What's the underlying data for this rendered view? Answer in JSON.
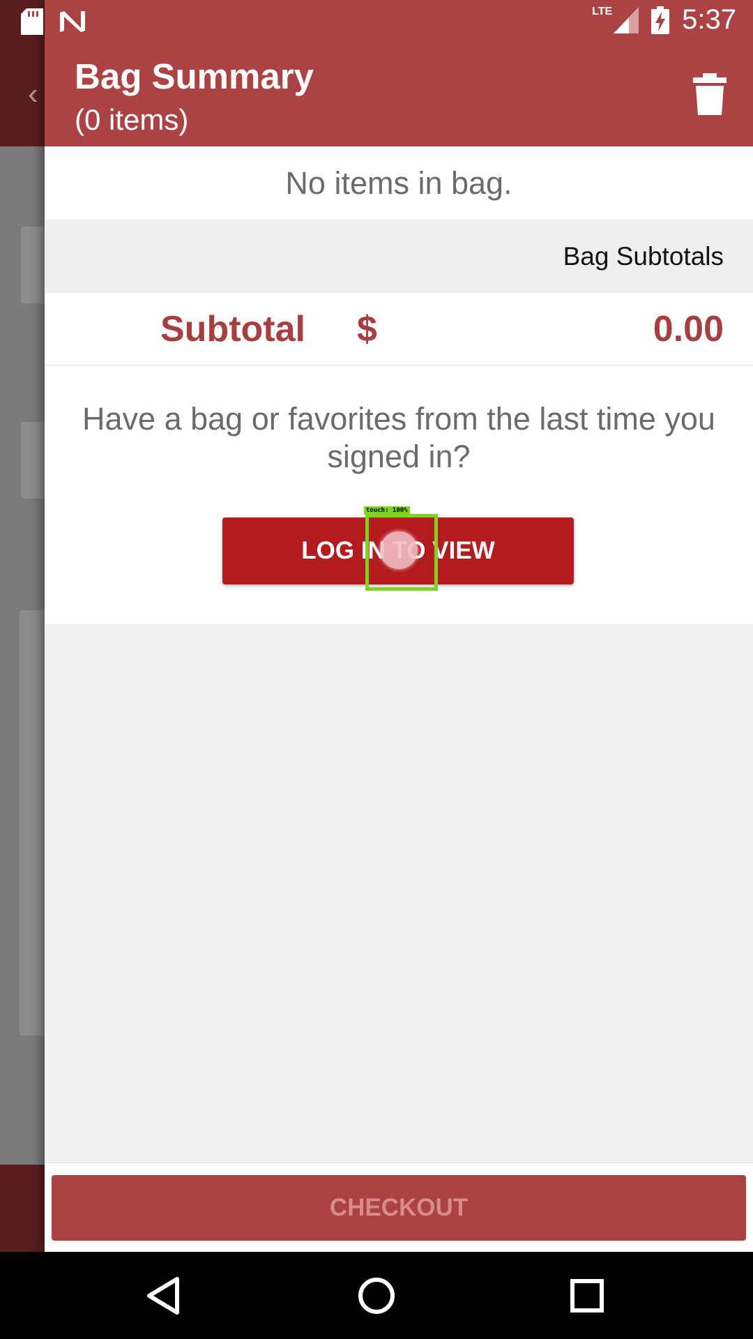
{
  "status_bar": {
    "time": "5:37",
    "network": "LTE",
    "icons": [
      "sd-card-icon",
      "n-logo-icon",
      "signal-icon",
      "battery-charging-icon"
    ]
  },
  "drawer": {
    "title": "Bag Summary",
    "subtitle": "(0 items)",
    "trash_icon": "trash-icon",
    "empty_message": "No items in bag.",
    "subtotals_header": "Bag Subtotals",
    "subtotal": {
      "label": "Subtotal",
      "currency": "$",
      "value": "0.00"
    },
    "login_prompt": "Have a bag or favorites from the last time you signed in?",
    "login_button": "LOG IN TO VIEW",
    "checkout_button": "CHECKOUT"
  },
  "touch_indicator": {
    "label": "touch: 100%"
  },
  "nav_bar": {
    "icons": [
      "back-icon",
      "home-icon",
      "recents-icon"
    ]
  },
  "colors": {
    "header": "#ab4244",
    "accent_text": "#a63e42",
    "login_button": "#b41b1e",
    "touch_highlight": "#7ed321"
  }
}
